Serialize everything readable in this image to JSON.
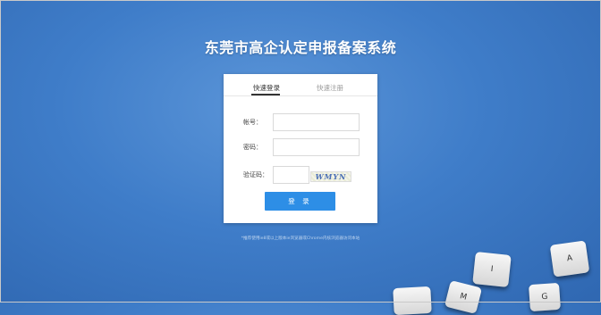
{
  "page": {
    "title": "东莞市高企认定申报备案系统",
    "browser_note": "*推荐使用ie8或以上版本ie浏览器或Chrome内核浏览器访问本站"
  },
  "login": {
    "tabs": [
      {
        "label": "快速登录",
        "active": true
      },
      {
        "label": "快速注册",
        "active": false
      }
    ],
    "account_label": "帐号：",
    "account_value": "",
    "password_label": "密码：",
    "password_value": "",
    "captcha_label": "验证码：",
    "captcha_value": "",
    "captcha_text": "WMYN",
    "submit_label": "登 录"
  },
  "decor": {
    "keys": [
      "A",
      "I",
      "M",
      "G"
    ]
  },
  "colors": {
    "background": "#3f7dc9",
    "button": "#2d8ee6",
    "title": "#ffffff"
  }
}
